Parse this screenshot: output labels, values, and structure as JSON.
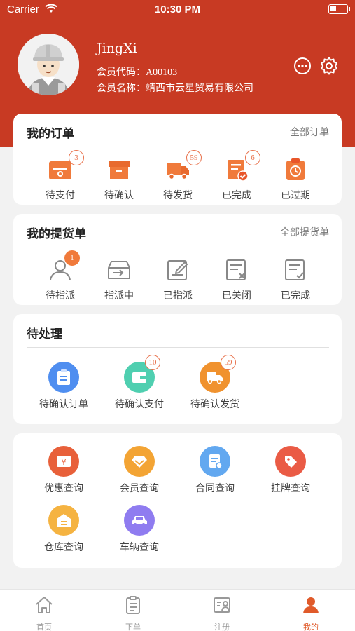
{
  "status_bar": {
    "carrier": "Carrier",
    "time": "10:30 PM"
  },
  "profile": {
    "name": "JingXi",
    "code_label": "会员代码：",
    "code_value": "A00103",
    "member_label": "会员名称：",
    "member_value": "靖西市云星贸易有限公司"
  },
  "orders": {
    "title": "我的订单",
    "link": "全部订单",
    "items": [
      {
        "label": "待支付",
        "badge": "3"
      },
      {
        "label": "待确认",
        "badge": ""
      },
      {
        "label": "待发货",
        "badge": "59"
      },
      {
        "label": "已完成",
        "badge": "6"
      },
      {
        "label": "已过期",
        "badge": ""
      }
    ]
  },
  "pickups": {
    "title": "我的提货单",
    "link": "全部提货单",
    "items": [
      {
        "label": "待指派",
        "badge": "1"
      },
      {
        "label": "指派中",
        "badge": ""
      },
      {
        "label": "已指派",
        "badge": ""
      },
      {
        "label": "已关闭",
        "badge": ""
      },
      {
        "label": "已完成",
        "badge": ""
      }
    ]
  },
  "pending": {
    "title": "待处理",
    "items": [
      {
        "label": "待确认订单",
        "badge": ""
      },
      {
        "label": "待确认支付",
        "badge": "10"
      },
      {
        "label": "待确认发货",
        "badge": "59"
      }
    ]
  },
  "queries": {
    "items": [
      {
        "label": "优惠查询"
      },
      {
        "label": "会员查询"
      },
      {
        "label": "合同查询"
      },
      {
        "label": "挂牌查询"
      },
      {
        "label": "仓库查询"
      },
      {
        "label": "车辆查询"
      }
    ]
  },
  "tabbar": {
    "items": [
      {
        "label": "首页"
      },
      {
        "label": "下单"
      },
      {
        "label": "注册"
      },
      {
        "label": "我的"
      }
    ]
  },
  "colors": {
    "brand_red": "#c83a23",
    "accent_orange": "#f07a3b",
    "active_tab": "#e05a2a"
  }
}
